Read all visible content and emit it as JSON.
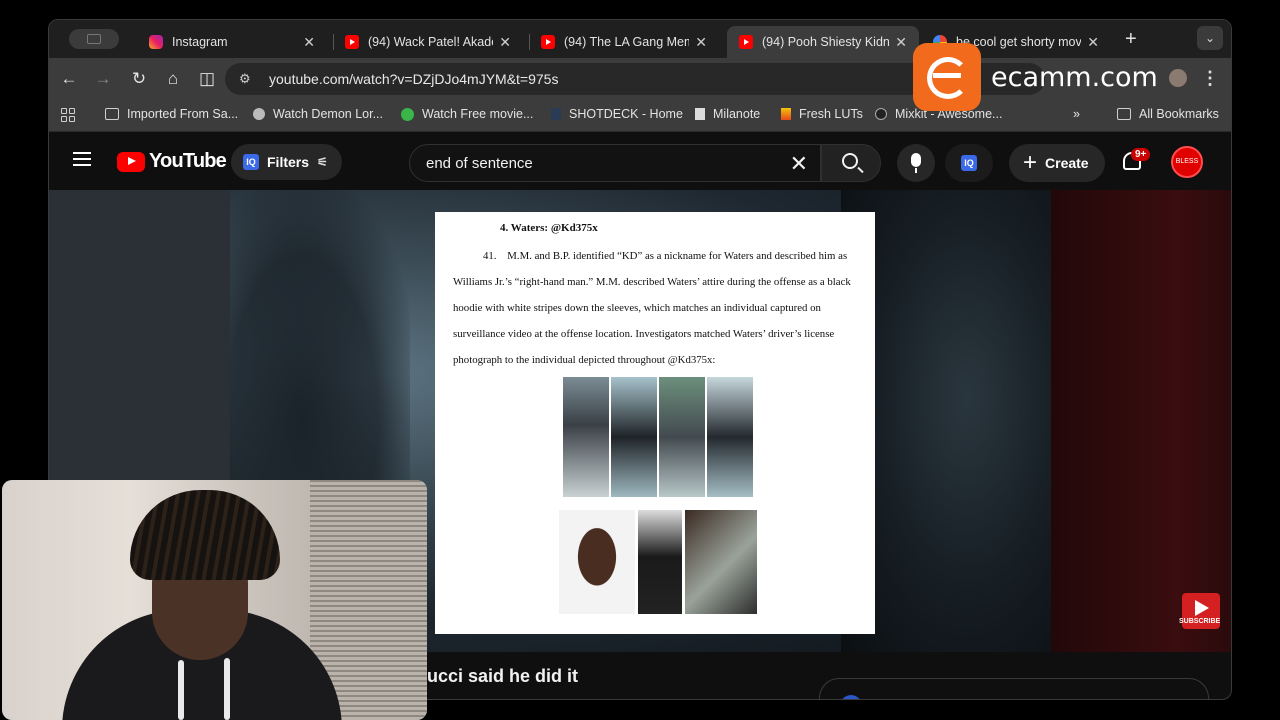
{
  "browser": {
    "tabs": [
      {
        "title": "Instagram",
        "favicon": "instagram-icon",
        "active": false
      },
      {
        "title": "(94) Wack Patel! Akade",
        "favicon": "youtube-icon",
        "active": false
      },
      {
        "title": "(94) The LA Gang Mem",
        "favicon": "youtube-icon",
        "active": false
      },
      {
        "title": "(94) Pooh Shiesty Kidn",
        "favicon": "youtube-icon",
        "active": true
      },
      {
        "title": "be cool get shorty mov",
        "favicon": "google-icon",
        "active": false
      }
    ],
    "url": "youtube.com/watch?v=DZjDJo4mJYM&t=975s",
    "bookmarks": [
      {
        "label": "Imported From Sa...",
        "icon": "folder-icon"
      },
      {
        "label": "Watch Demon Lor...",
        "icon": "site-icon"
      },
      {
        "label": "Watch Free movie...",
        "icon": "play-icon"
      },
      {
        "label": "SHOTDECK - Home",
        "icon": "shotdeck-icon"
      },
      {
        "label": "Milanote",
        "icon": "milanote-icon"
      },
      {
        "label": "Fresh LUTs",
        "icon": "flame-icon"
      },
      {
        "label": "Mixkit - Awesome...",
        "icon": "mixkit-icon"
      }
    ],
    "all_bookmarks": "All Bookmarks"
  },
  "youtube": {
    "logo_text": "YouTube",
    "filters_label": "Filters",
    "iq_badge": "IQ",
    "search_query": "end of sentence",
    "create_label": "Create",
    "notification_count": "9+",
    "avatar_text": "BLESS",
    "subscribe_text": "SUBSCRIBE",
    "video_title_visible": "ucci said he did it"
  },
  "document": {
    "heading": "4.   Waters: @Kd375x",
    "para_number": "41.",
    "paragraph": "M.M. and B.P. identified “KD” as a nickname for Waters and described him as Williams Jr.’s “right-hand man.” M.M. described Waters’ attire during the offense as a black hoodie with white stripes down the sleeves, which matches an individual captured on surveillance video at the offense location. Investigators matched Waters’ driver’s license photograph to the individual depicted throughout @Kd375x:"
  },
  "overlay": {
    "brand_text": "ecamm.com"
  },
  "colors": {
    "yt_red": "#ff0000",
    "ecamm_orange": "#f26b1d",
    "browser_bg": "#3c3c3c"
  }
}
